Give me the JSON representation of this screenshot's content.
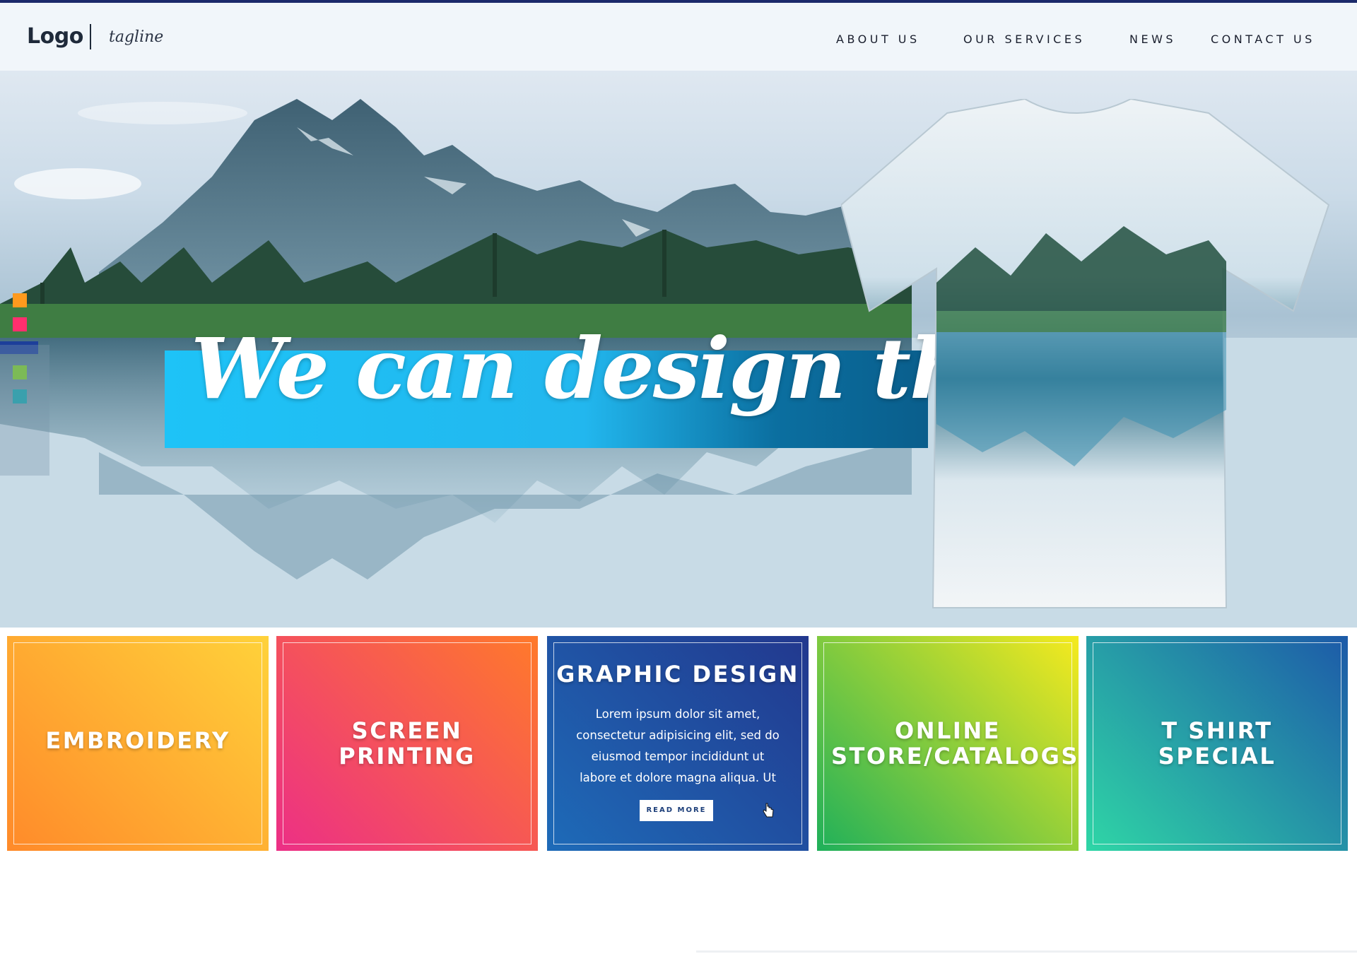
{
  "header": {
    "logo": "Logo",
    "tagline": "tagline",
    "nav": [
      "ABOUT US",
      "OUR SERVICES",
      "NEWS",
      "CONTACT US"
    ]
  },
  "hero": {
    "headline": "We can design that"
  },
  "swatches": [
    "#ff9a1e",
    "#ff2f6e",
    "#1d3f9a",
    "#7fce2a",
    "#1aa6b0"
  ],
  "tiles": [
    {
      "title": "EMBROIDERY",
      "colors": [
        "#ff8a2a",
        "#ffd23a"
      ]
    },
    {
      "title": "SCREEN PRINTING",
      "colors": [
        "#ec2f86",
        "#ff7a2a"
      ]
    },
    {
      "title": "GRAPHIC DESIGN",
      "text": "Lorem ipsum dolor sit amet, consectetur adipisicing elit, sed do eiusmod tempor incididunt ut labore et dolore magna aliqua. Ut",
      "button": "READ MORE",
      "colors": [
        "#1e6bb8",
        "#22388e"
      ]
    },
    {
      "title": "ONLINE STORE/CATALOGS",
      "colors": [
        "#1fb05a",
        "#f6ea1e"
      ]
    },
    {
      "title": "T SHIRT SPECIAL",
      "colors": [
        "#2fd6a6",
        "#1d5aa8"
      ]
    }
  ]
}
